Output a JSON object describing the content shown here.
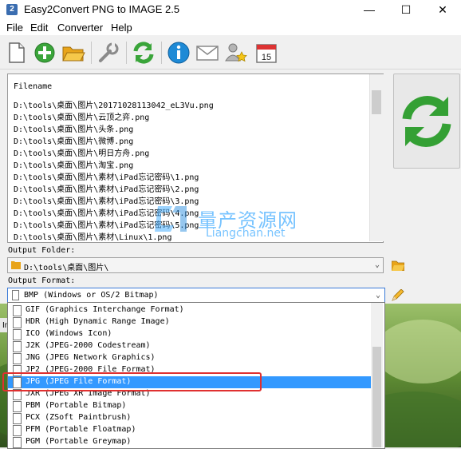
{
  "window": {
    "title": "Easy2Convert PNG to IMAGE 2.5",
    "app_icon_text": "2",
    "controls": {
      "minimize": "—",
      "maximize": "☐",
      "close": "✕"
    }
  },
  "menu": [
    "File",
    "Edit",
    "Converter",
    "Help"
  ],
  "toolbar": {
    "icons": [
      "new-document-icon",
      "add-icon",
      "open-folder-icon",
      "settings-wrench-icon",
      "convert-icon",
      "info-icon",
      "email-icon",
      "user-star-icon",
      "calendar-icon"
    ],
    "calendar_day": "15"
  },
  "file_list": {
    "header": "Filename",
    "rows": [
      "D:\\tools\\桌面\\图片\\20171028113042_eL3Vu.png",
      "D:\\tools\\桌面\\图片\\云顶之弈.png",
      "D:\\tools\\桌面\\图片\\头条.png",
      "D:\\tools\\桌面\\图片\\微博.png",
      "D:\\tools\\桌面\\图片\\明日方舟.png",
      "D:\\tools\\桌面\\图片\\淘宝.png",
      "D:\\tools\\桌面\\图片\\素材\\iPad忘记密码\\1.png",
      "D:\\tools\\桌面\\图片\\素材\\iPad忘记密码\\2.png",
      "D:\\tools\\桌面\\图片\\素材\\iPad忘记密码\\3.png",
      "D:\\tools\\桌面\\图片\\素材\\iPad忘记密码\\4.png",
      "D:\\tools\\桌面\\图片\\素材\\iPad忘记密码\\5.png",
      "D:\\tools\\桌面\\图片\\素材\\Linux\\1.png"
    ]
  },
  "output_folder": {
    "label": "Output Folder:",
    "value": "D:\\tools\\桌面\\图片\\"
  },
  "output_format": {
    "label": "Output Format:",
    "value": "BMP (Windows or OS/2 Bitmap)",
    "options": [
      "GIF (Graphics Interchange Format)",
      "HDR (High Dynamic Range Image)",
      "ICO (Windows Icon)",
      "J2K (JPEG-2000 Codestream)",
      "JNG (JPEG Network Graphics)",
      "JP2 (JPEG-2000 File Format)",
      "JPG (JPEG File Format)",
      "JXR (JPEG XR Image Format)",
      "PBM (Portable Bitmap)",
      "PCX (ZSoft Paintbrush)",
      "PFM (Portable Floatmap)",
      "PGM (Portable Greymap)"
    ],
    "selected_index": 6
  },
  "status_text": "In",
  "watermark": {
    "chinese": "量产资源网",
    "url": "Liangchan.net"
  },
  "colors": {
    "selection": "#3399ff",
    "highlight_box": "#e03030",
    "accent_green": "#3aa53a"
  }
}
